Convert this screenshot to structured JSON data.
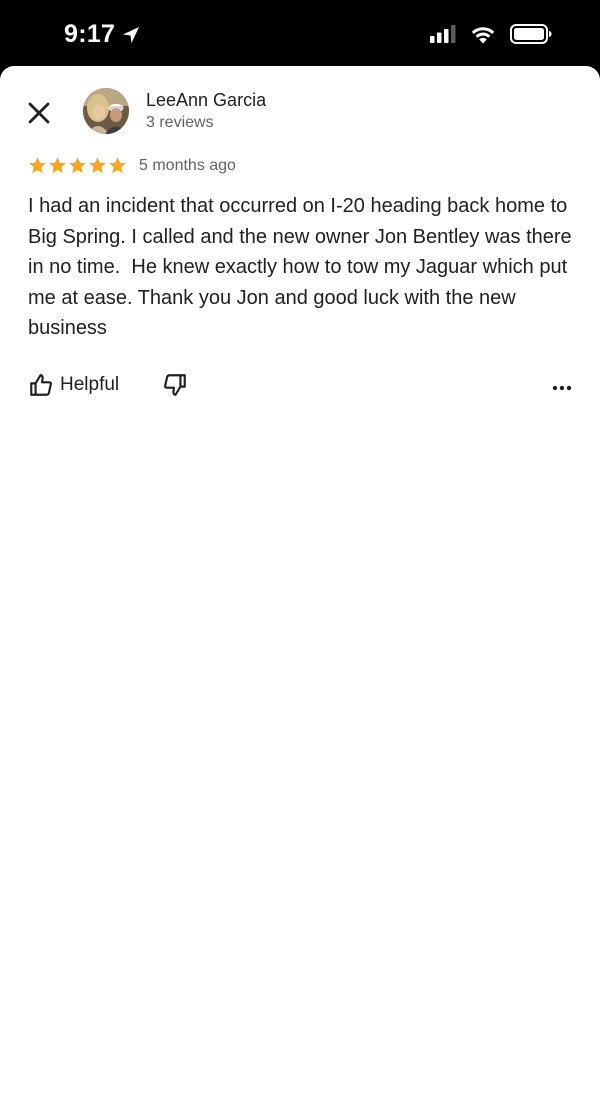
{
  "status_bar": {
    "time": "9:17",
    "icons": [
      "location-arrow-icon",
      "signal-icon",
      "wifi-icon",
      "battery-icon"
    ]
  },
  "review": {
    "close_icon": "close-icon",
    "reviewer": {
      "name": "LeeAnn Garcia",
      "reviews_count": "3 reviews",
      "avatar": "avatar-photo"
    },
    "rating": 5,
    "rating_max": 5,
    "time_ago": "5 months ago",
    "text": "I had an incident that occurred on I-20 heading back home to Big Spring. I called and the new owner Jon Bentley was there in no time.  He knew exactly how to tow my Jaguar which put me at ease. Thank you Jon and good luck with the new business",
    "actions": {
      "helpful_label": "Helpful",
      "helpful_icon": "thumbs-up-icon",
      "not_helpful_icon": "thumbs-down-icon",
      "more_icon": "more-horizontal-icon"
    }
  },
  "colors": {
    "star": "#F5A623",
    "text_primary": "#202124",
    "text_secondary": "#5F6368",
    "status_bar_bg": "#000000",
    "sheet_bg": "#FFFFFF"
  }
}
